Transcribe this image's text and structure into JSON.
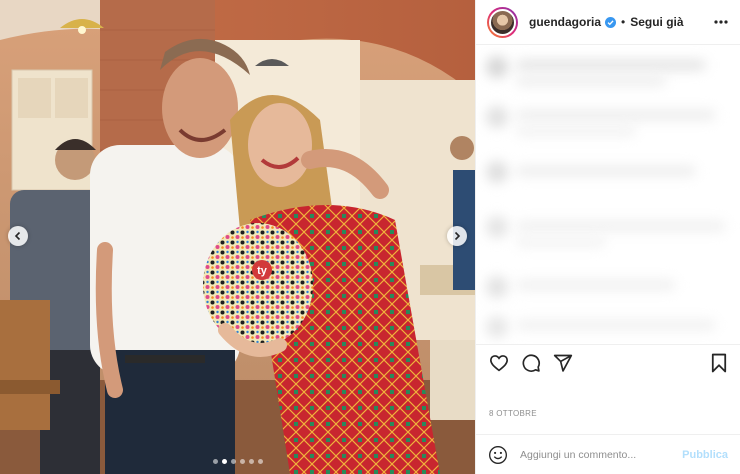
{
  "post": {
    "photo": {
      "slide_count": 6,
      "active_slide": 1
    }
  },
  "header": {
    "username": "guendagoria",
    "separator": "•",
    "follow_label": "Segui già"
  },
  "icons": {
    "more": "more-horizontal-icon",
    "verified": "verified-badge-icon",
    "like": "heart-icon",
    "comment": "comment-icon",
    "share": "share-icon",
    "save": "bookmark-icon",
    "emoji": "emoji-icon",
    "prev": "chevron-left-icon",
    "next": "chevron-right-icon"
  },
  "meta": {
    "date": "8 OTTOBRE"
  },
  "comment_box": {
    "placeholder": "Aggiungi un commento...",
    "publish_label": "Pubblica"
  },
  "colors": {
    "verified": "#3897f0",
    "publish_disabled": "#b2dffc",
    "muted_text": "#8e8e8e",
    "border": "#efefef"
  }
}
